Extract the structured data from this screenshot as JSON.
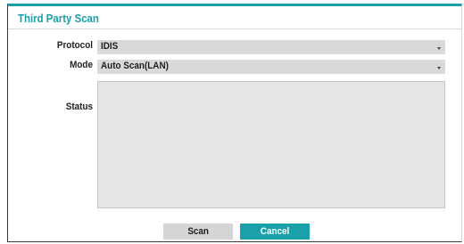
{
  "dialog": {
    "title": "Third Party Scan",
    "accent_color": "#1aa0a8"
  },
  "form": {
    "protocol_label": "Protocol",
    "protocol_value": "IDIS",
    "mode_label": "Mode",
    "mode_value": "Auto Scan(LAN)",
    "status_label": "Status",
    "status_value": ""
  },
  "buttons": {
    "scan_label": "Scan",
    "cancel_label": "Cancel"
  },
  "icons": {
    "dropdown": "chevron-down-icon"
  }
}
